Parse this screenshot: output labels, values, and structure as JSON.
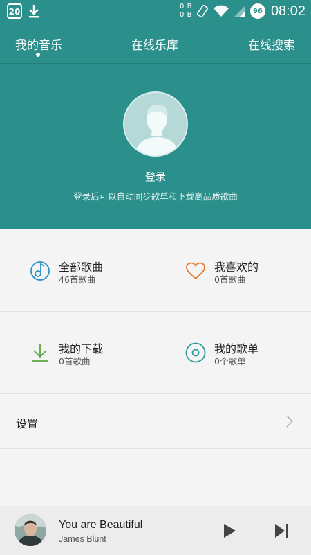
{
  "status_bar": {
    "calendar_day": "20",
    "net_up": "0 B",
    "net_down": "0 B",
    "battery": "96",
    "time": "08:02"
  },
  "tabs": [
    "我的音乐",
    "在线乐库",
    "在线搜索"
  ],
  "profile": {
    "login_label": "登录",
    "login_desc": "登录后可以自动同步歌单和下载高品质歌曲"
  },
  "grid": {
    "all_songs": {
      "title": "全部歌曲",
      "sub": "46首歌曲",
      "icon": "music-note-icon"
    },
    "favorites": {
      "title": "我喜欢的",
      "sub": "0首歌曲",
      "icon": "heart-icon"
    },
    "downloads": {
      "title": "我的下载",
      "sub": "0首歌曲",
      "icon": "download-icon"
    },
    "playlists": {
      "title": "我的歌单",
      "sub": "0个歌单",
      "icon": "disc-icon"
    }
  },
  "settings": {
    "label": "设置"
  },
  "player": {
    "title": "You are Beautiful",
    "artist": "James Blunt"
  },
  "colors": {
    "accent": "#2b8f8c",
    "music_icon": "#2a92c7",
    "heart_icon": "#e07a2d",
    "download_icon": "#5aa640",
    "disc_icon": "#2b9c9a"
  }
}
